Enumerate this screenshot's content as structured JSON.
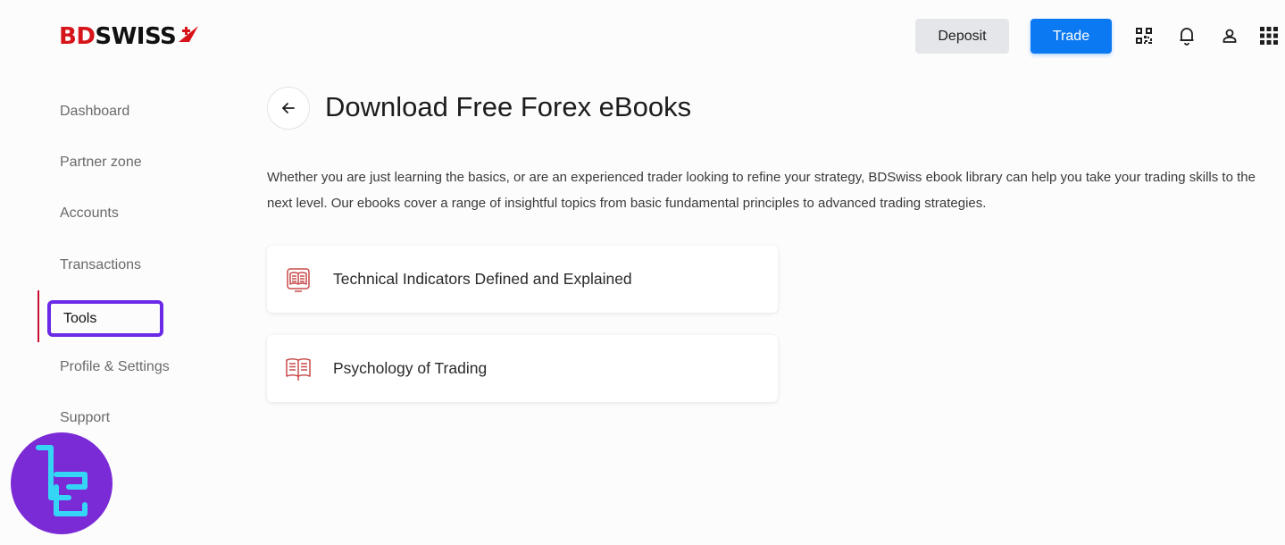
{
  "brand": {
    "part1": "BD",
    "part2": "SWISS"
  },
  "header": {
    "deposit_label": "Deposit",
    "trade_label": "Trade",
    "icons": [
      "qr-code-icon",
      "bell-icon",
      "user-icon",
      "apps-grid-icon"
    ]
  },
  "sidebar": {
    "items": [
      {
        "label": "Dashboard"
      },
      {
        "label": "Partner zone"
      },
      {
        "label": "Accounts"
      },
      {
        "label": "Transactions"
      },
      {
        "label": "Tools",
        "active": true
      },
      {
        "label": "Profile & Settings"
      },
      {
        "label": "Support"
      }
    ],
    "active_color": "#c8102e",
    "highlight_color": "#6a2ae6"
  },
  "main": {
    "title": "Download Free Forex eBooks",
    "intro": "Whether you are just learning the basics, or are an experienced trader looking to refine your strategy, BDSwiss ebook library can help you take your trading skills to the next level. Our ebooks cover a range of insightful topics from basic fundamental principles to advanced trading strategies.",
    "ebooks": [
      {
        "title": "Technical Indicators Defined and Explained",
        "icon": "ebook-device-icon"
      },
      {
        "title": "Psychology of Trading",
        "icon": "open-book-icon"
      }
    ]
  },
  "colors": {
    "brand_red": "#d7141a",
    "trade_blue": "#0b79f2",
    "badge_purple": "#7b2bd6",
    "badge_cyan": "#35d6f5"
  }
}
